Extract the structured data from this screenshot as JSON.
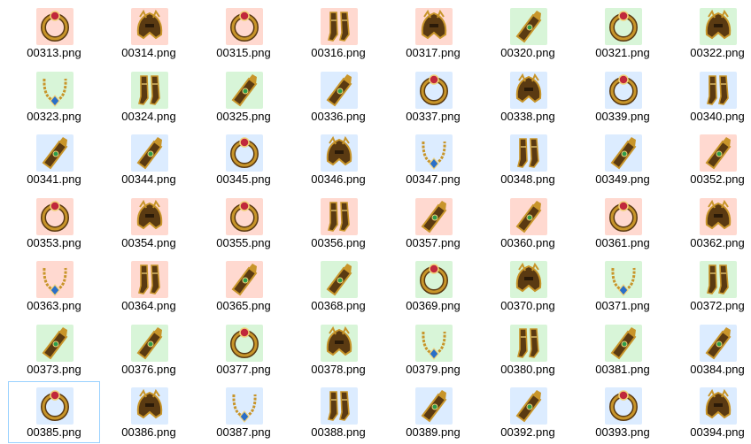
{
  "files": [
    {
      "name": "00313.png",
      "icon": "ring-icon",
      "bg": "#ffd9d0"
    },
    {
      "name": "00314.png",
      "icon": "helmet-icon",
      "bg": "#ffd9d0"
    },
    {
      "name": "00315.png",
      "icon": "ring-icon",
      "bg": "#ffd9d0"
    },
    {
      "name": "00316.png",
      "icon": "boots-icon",
      "bg": "#ffd9d0"
    },
    {
      "name": "00317.png",
      "icon": "helmet-icon",
      "bg": "#ffd9d0"
    },
    {
      "name": "00320.png",
      "icon": "bracer-icon",
      "bg": "#d8f5d8"
    },
    {
      "name": "00321.png",
      "icon": "ring-icon",
      "bg": "#d8f5d8"
    },
    {
      "name": "00322.png",
      "icon": "helmet-icon",
      "bg": "#d8f5d8"
    },
    {
      "name": "00323.png",
      "icon": "necklace-icon",
      "bg": "#d8f5d8"
    },
    {
      "name": "00324.png",
      "icon": "boots-icon",
      "bg": "#d8f5d8"
    },
    {
      "name": "00325.png",
      "icon": "bracer-icon",
      "bg": "#d8f5d8"
    },
    {
      "name": "00336.png",
      "icon": "bracer-icon",
      "bg": "#dcecff"
    },
    {
      "name": "00337.png",
      "icon": "ring-icon",
      "bg": "#dcecff"
    },
    {
      "name": "00338.png",
      "icon": "helmet-icon",
      "bg": "#dcecff"
    },
    {
      "name": "00339.png",
      "icon": "ring-icon",
      "bg": "#dcecff"
    },
    {
      "name": "00340.png",
      "icon": "boots-icon",
      "bg": "#dcecff"
    },
    {
      "name": "00341.png",
      "icon": "bracer-icon",
      "bg": "#dcecff"
    },
    {
      "name": "00344.png",
      "icon": "bracer-icon",
      "bg": "#dcecff"
    },
    {
      "name": "00345.png",
      "icon": "ring-icon",
      "bg": "#dcecff"
    },
    {
      "name": "00346.png",
      "icon": "helmet-icon",
      "bg": "#dcecff"
    },
    {
      "name": "00347.png",
      "icon": "necklace-icon",
      "bg": "#dcecff"
    },
    {
      "name": "00348.png",
      "icon": "boots-icon",
      "bg": "#dcecff"
    },
    {
      "name": "00349.png",
      "icon": "bracer-icon",
      "bg": "#dcecff"
    },
    {
      "name": "00352.png",
      "icon": "bracer-icon",
      "bg": "#ffd9d0"
    },
    {
      "name": "00353.png",
      "icon": "ring-icon",
      "bg": "#ffd9d0"
    },
    {
      "name": "00354.png",
      "icon": "helmet-icon",
      "bg": "#ffd9d0"
    },
    {
      "name": "00355.png",
      "icon": "ring-icon",
      "bg": "#ffd9d0"
    },
    {
      "name": "00356.png",
      "icon": "boots-icon",
      "bg": "#ffd9d0"
    },
    {
      "name": "00357.png",
      "icon": "bracer-icon",
      "bg": "#ffd9d0"
    },
    {
      "name": "00360.png",
      "icon": "bracer-icon",
      "bg": "#ffd9d0"
    },
    {
      "name": "00361.png",
      "icon": "ring-icon",
      "bg": "#ffd9d0"
    },
    {
      "name": "00362.png",
      "icon": "helmet-icon",
      "bg": "#ffd9d0"
    },
    {
      "name": "00363.png",
      "icon": "necklace-icon",
      "bg": "#ffd9d0"
    },
    {
      "name": "00364.png",
      "icon": "boots-icon",
      "bg": "#ffd9d0"
    },
    {
      "name": "00365.png",
      "icon": "bracer-icon",
      "bg": "#ffd9d0"
    },
    {
      "name": "00368.png",
      "icon": "bracer-icon",
      "bg": "#d8f5d8"
    },
    {
      "name": "00369.png",
      "icon": "ring-icon",
      "bg": "#d8f5d8"
    },
    {
      "name": "00370.png",
      "icon": "helmet-icon",
      "bg": "#d8f5d8"
    },
    {
      "name": "00371.png",
      "icon": "necklace-icon",
      "bg": "#d8f5d8"
    },
    {
      "name": "00372.png",
      "icon": "boots-icon",
      "bg": "#d8f5d8"
    },
    {
      "name": "00373.png",
      "icon": "bracer-icon",
      "bg": "#d8f5d8"
    },
    {
      "name": "00376.png",
      "icon": "bracer-icon",
      "bg": "#d8f5d8"
    },
    {
      "name": "00377.png",
      "icon": "ring-icon",
      "bg": "#d8f5d8"
    },
    {
      "name": "00378.png",
      "icon": "helmet-icon",
      "bg": "#d8f5d8"
    },
    {
      "name": "00379.png",
      "icon": "necklace-icon",
      "bg": "#d8f5d8"
    },
    {
      "name": "00380.png",
      "icon": "boots-icon",
      "bg": "#d8f5d8"
    },
    {
      "name": "00381.png",
      "icon": "bracer-icon",
      "bg": "#d8f5d8"
    },
    {
      "name": "00384.png",
      "icon": "bracer-icon",
      "bg": "#dcecff"
    },
    {
      "name": "00385.png",
      "icon": "ring-icon",
      "bg": "#dcecff"
    },
    {
      "name": "00386.png",
      "icon": "helmet-icon",
      "bg": "#dcecff"
    },
    {
      "name": "00387.png",
      "icon": "necklace-icon",
      "bg": "#dcecff"
    },
    {
      "name": "00388.png",
      "icon": "boots-icon",
      "bg": "#dcecff"
    },
    {
      "name": "00389.png",
      "icon": "bracer-icon",
      "bg": "#dcecff"
    },
    {
      "name": "00392.png",
      "icon": "bracer-icon",
      "bg": "#dcecff"
    },
    {
      "name": "00393.png",
      "icon": "ring-icon",
      "bg": "#dcecff"
    },
    {
      "name": "00394.png",
      "icon": "helmet-icon",
      "bg": "#dcecff"
    }
  ],
  "selected_file": "00385.png"
}
